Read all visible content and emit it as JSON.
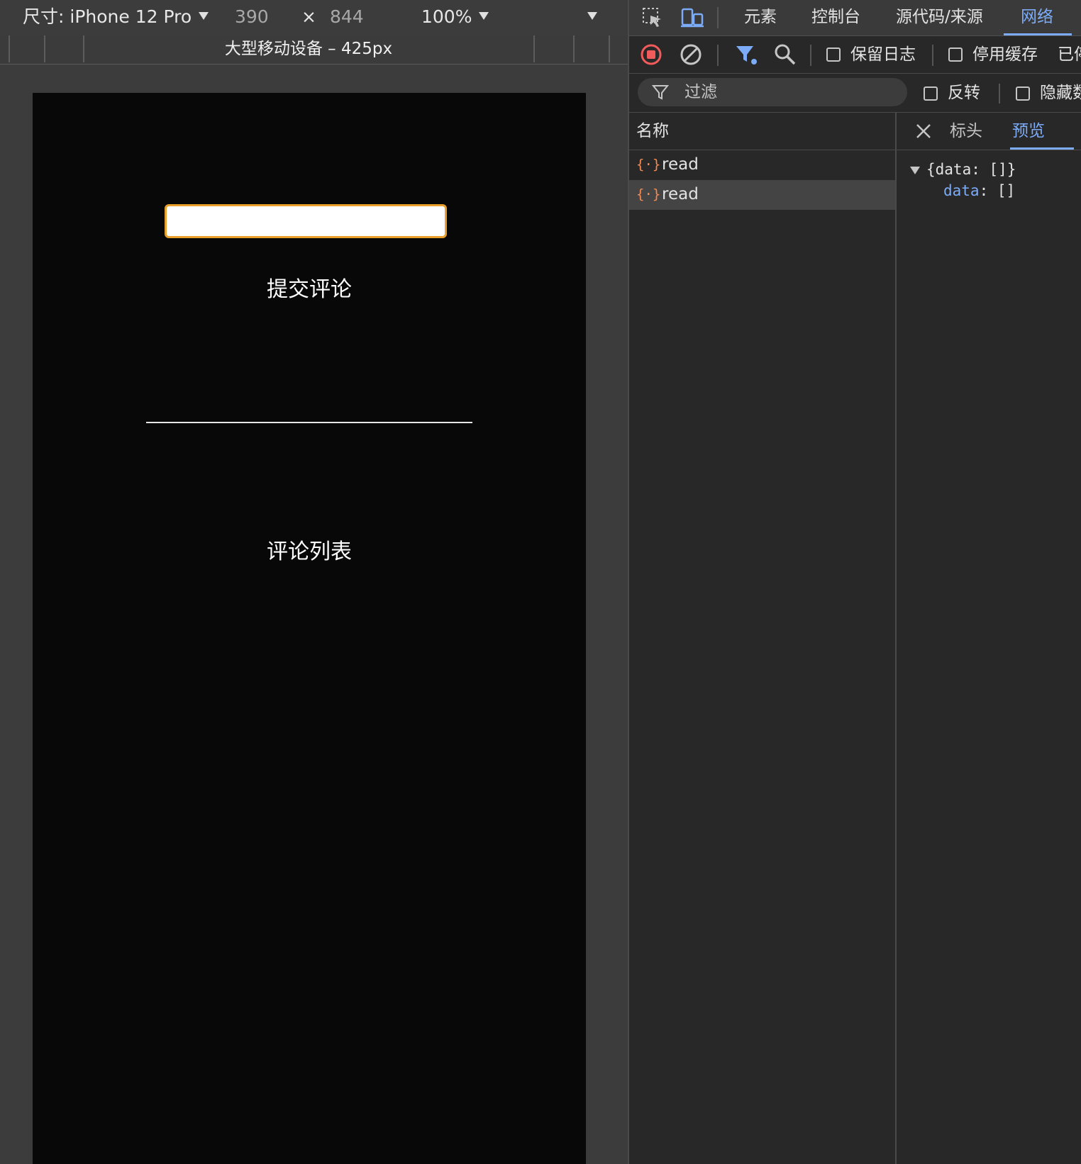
{
  "device_toolbar": {
    "dimension_label": "尺寸: iPhone 12 Pro",
    "width": "390",
    "times": "×",
    "height": "844",
    "zoom": "100%"
  },
  "media_query_bar": {
    "label": "大型移动设备 – 425px"
  },
  "viewport": {
    "comment_input_value": "",
    "submit_label": "提交评论",
    "list_title": "评论列表"
  },
  "devtools": {
    "tabs": [
      "元素",
      "控制台",
      "源代码/来源",
      "网络"
    ],
    "active_tab": "网络",
    "toolbar": {
      "preserve_log": "保留日志",
      "disable_cache": "停用缓存",
      "overflow_text": "已停"
    },
    "filter": {
      "placeholder": "过滤",
      "invert": "反转",
      "hide_data": "隐藏数"
    },
    "name_column_header": "名称",
    "requests": [
      {
        "icon": "{·}",
        "name": "read"
      },
      {
        "icon": "{·}",
        "name": "read"
      }
    ],
    "detail_tabs": {
      "headers": "标头",
      "preview": "预览"
    },
    "preview": {
      "line1": "{data: []}",
      "key": "data",
      "sep": ": ",
      "value": "[]"
    }
  },
  "colors": {
    "accent_blue": "#7cacf8",
    "record_red": "#f25b5b",
    "input_border": "#e8a02a",
    "json_icon": "#f28b54"
  }
}
